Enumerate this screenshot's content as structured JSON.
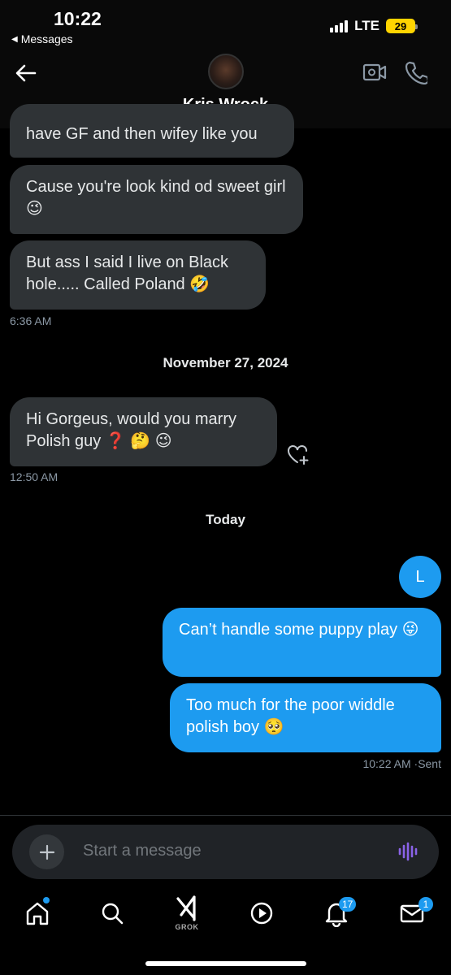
{
  "status_bar": {
    "time": "10:22",
    "back_label": "Messages",
    "network": "LTE",
    "battery": "29"
  },
  "header": {
    "contact_name": "Kris Wrock"
  },
  "messages": [
    {
      "text": "have GF and then wifey like you"
    },
    {
      "text": "Cause you're look kind od sweet girl 😉"
    },
    {
      "text": "But ass I said I live on Black hole..... Called Poland 🤣"
    },
    {
      "timestamp": "6:36 AM"
    },
    {
      "date": "November 27, 2024"
    },
    {
      "text": "Hi Gorgeus, would you marry Polish guy ❓ 🤔 😉"
    },
    {
      "timestamp": "12:50 AM"
    },
    {
      "date": "Today"
    },
    {
      "avatar_letter": "L"
    },
    {
      "text": "Can’t handle some puppy play 😜"
    },
    {
      "text": "Too much for the poor widdle polish boy 🥺"
    },
    {
      "timestamp": "10:22 AM",
      "status": "Sent"
    }
  ],
  "composer": {
    "placeholder": "Start a message"
  },
  "nav": {
    "grok_label": "GROK",
    "notifications_badge": "17",
    "messages_badge": "1"
  },
  "colors": {
    "accent": "#1d9bf0",
    "bubble_incoming": "#2f3336",
    "background": "#000000"
  }
}
